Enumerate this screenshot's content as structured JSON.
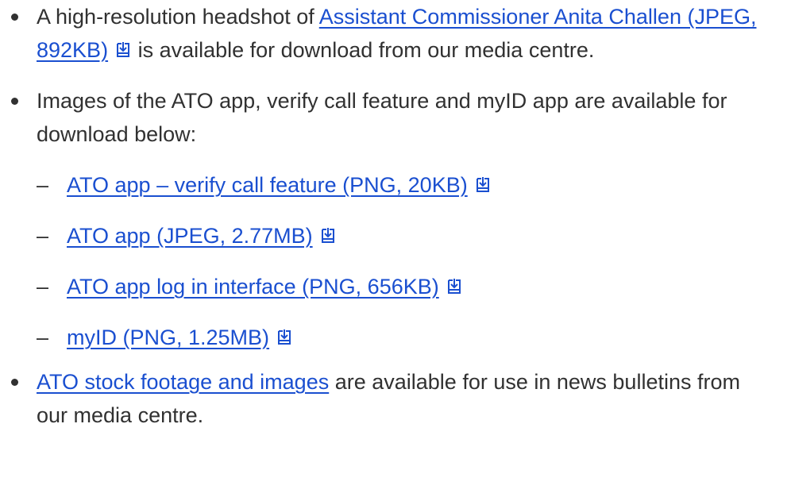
{
  "bullets": {
    "headshot": {
      "prefix": "A high-resolution headshot of ",
      "link": "Assistant Commissioner Anita Challen (JPEG, 892KB)",
      "suffix": " is available for download from our media centre.",
      "icon": "download-icon"
    },
    "images": {
      "text": "Images of the ATO app, verify call feature and myID app are available for download below:",
      "dash": "–",
      "items": [
        {
          "link": "ATO app – verify call feature (PNG, 20KB)",
          "icon": "download-icon"
        },
        {
          "link": "ATO app (JPEG, 2.77MB)",
          "icon": "download-icon"
        },
        {
          "link": "ATO app log in interface (PNG, 656KB)",
          "icon": "download-icon"
        },
        {
          "link": "myID (PNG, 1.25MB)",
          "icon": "download-icon"
        }
      ]
    },
    "footage": {
      "link": "ATO stock footage and images",
      "suffix": " are available for use in news bulletins from our media centre."
    }
  },
  "colors": {
    "text": "#313131",
    "link": "#1a4fd0"
  }
}
